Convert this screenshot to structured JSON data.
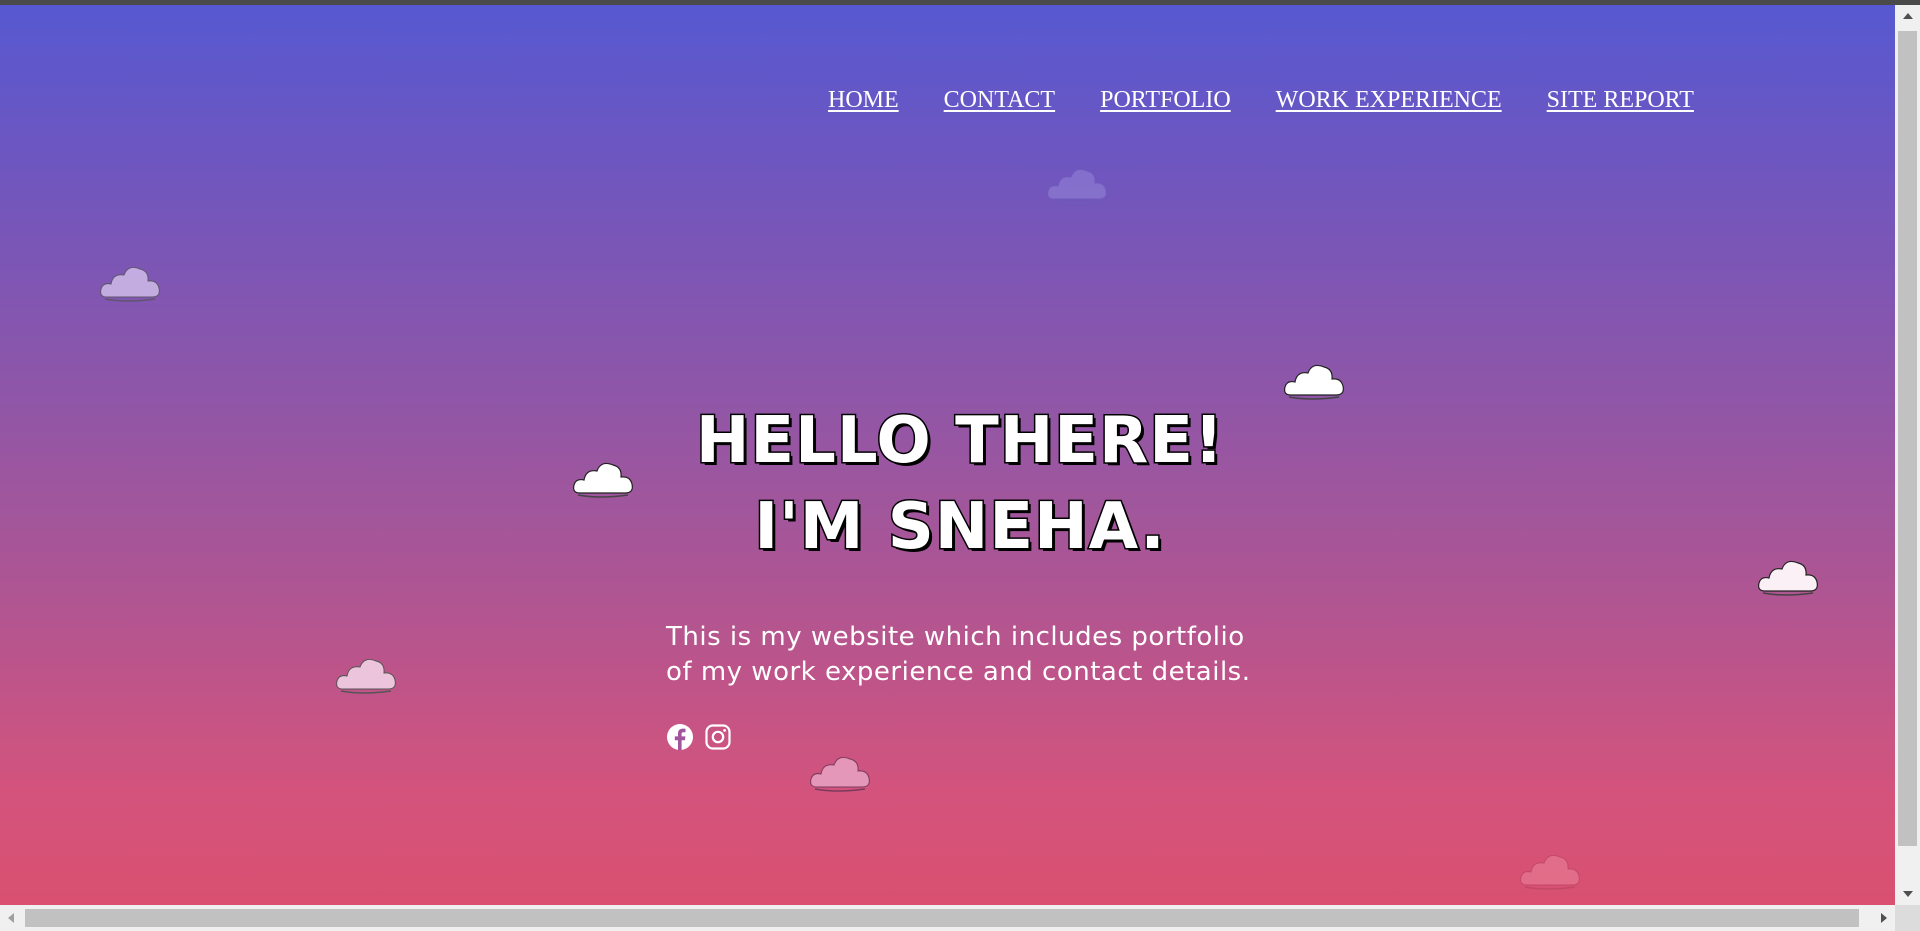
{
  "nav": {
    "items": [
      {
        "label": "HOME"
      },
      {
        "label": "CONTACT"
      },
      {
        "label": "PORTFOLIO"
      },
      {
        "label": "WORK EXPERIENCE"
      },
      {
        "label": "SITE REPORT"
      }
    ]
  },
  "hero": {
    "heading_line1": "HELLO THERE!",
    "heading_line2": "I'M SNEHA.",
    "intro_line1": "This is my website which includes portfolio",
    "intro_line2": "of my work experience and contact details."
  },
  "social": {
    "icons": [
      "facebook-icon",
      "instagram-icon"
    ]
  },
  "colors": {
    "gradient_top": "#5758d1",
    "gradient_bottom": "#d95070",
    "text": "#ffffff"
  }
}
